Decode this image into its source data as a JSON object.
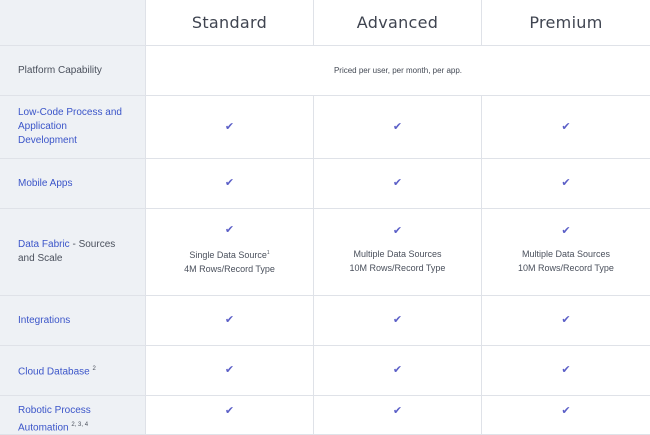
{
  "columns": [
    "Standard",
    "Advanced",
    "Premium"
  ],
  "pricing_note": "Priced per user, per month, per app.",
  "check_glyph": "✔",
  "check_color": "#5b5fc7",
  "rows": {
    "platform_capability": "Platform Capability",
    "low_code": "Low-Code Process and Application Development",
    "mobile_apps": "Mobile Apps",
    "data_fabric_link": "Data Fabric",
    "data_fabric_rest": " - Sources and Scale",
    "integrations": "Integrations",
    "cloud_database": "Cloud Database",
    "cloud_database_sup": "2",
    "robotic": "Robotic Process Automation",
    "robotic_sup": "2, 3, 4"
  },
  "data_fabric_notes": {
    "standard": [
      "Single Data Source",
      "4M Rows/Record Type"
    ],
    "standard_sup": "1",
    "advanced": [
      "Multiple Data Sources",
      "10M Rows/Record Type"
    ],
    "premium": [
      "Multiple Data Sources",
      "10M Rows/Record Type"
    ]
  }
}
